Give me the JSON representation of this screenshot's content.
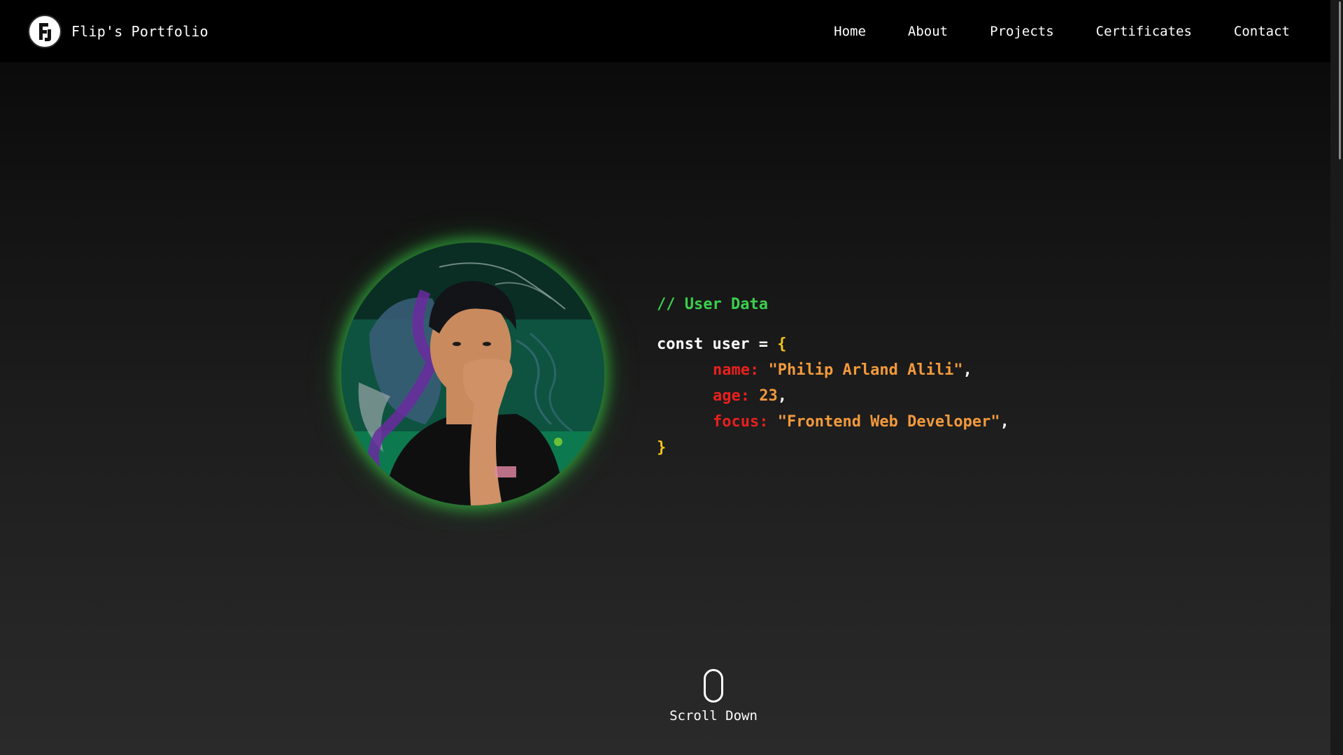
{
  "navbar": {
    "brand_name": "Flip's Portfolio",
    "links": [
      "Home",
      "About",
      "Projects",
      "Certificates",
      "Contact"
    ]
  },
  "hero": {
    "comment": "// User Data",
    "code": {
      "keyword": "const",
      "variable": "user",
      "equals": "=",
      "open_brace": "{",
      "close_brace": "}",
      "fields": [
        {
          "key": "name:",
          "value": "\"Philip Arland Alili\"",
          "suffix": ","
        },
        {
          "key": "age:",
          "value": "23",
          "suffix": ","
        },
        {
          "key": "focus:",
          "value": "\"Frontend Web Developer\"",
          "suffix": ","
        }
      ]
    },
    "scroll_label": "Scroll Down"
  },
  "colors": {
    "comment": "#3ccf4e",
    "brace": "#f5c518",
    "property": "#e8201e",
    "string": "#f29a3c",
    "glow": "#3cd246",
    "avatar_bg": "#0b3a2c"
  },
  "icons": {
    "logo": "fl-monogram-logo",
    "scroll": "mouse-icon"
  }
}
